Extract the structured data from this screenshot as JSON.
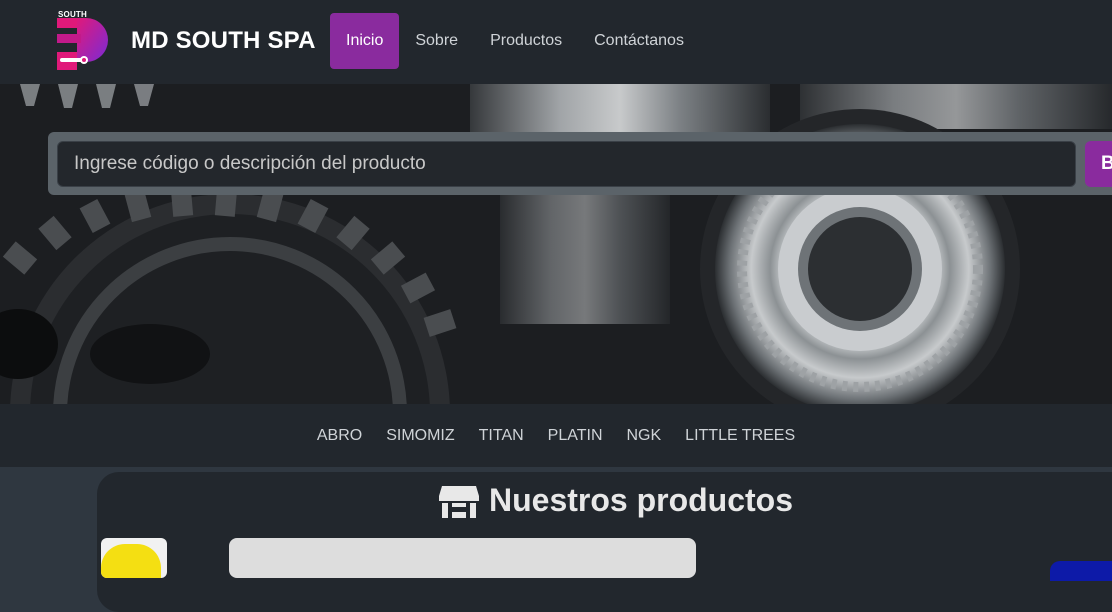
{
  "navbar": {
    "logo_text": "SOUTH",
    "brand": "MD SOUTH SPA",
    "items": [
      {
        "label": "Inicio",
        "active": true
      },
      {
        "label": "Sobre",
        "active": false
      },
      {
        "label": "Productos",
        "active": false
      },
      {
        "label": "Contáctanos",
        "active": false
      }
    ]
  },
  "search": {
    "placeholder": "Ingrese código o descripción del producto",
    "button_label": "B"
  },
  "brands": [
    "ABRO",
    "SIMOMIZ",
    "TITAN",
    "PLATIN",
    "NGK",
    "LITTLE TREES"
  ],
  "products": {
    "title": "Nuestros productos",
    "icon": "store-icon"
  },
  "colors": {
    "accent": "#8a2b9e",
    "navbar_bg": "#22272d",
    "page_bg": "#2f3740"
  }
}
